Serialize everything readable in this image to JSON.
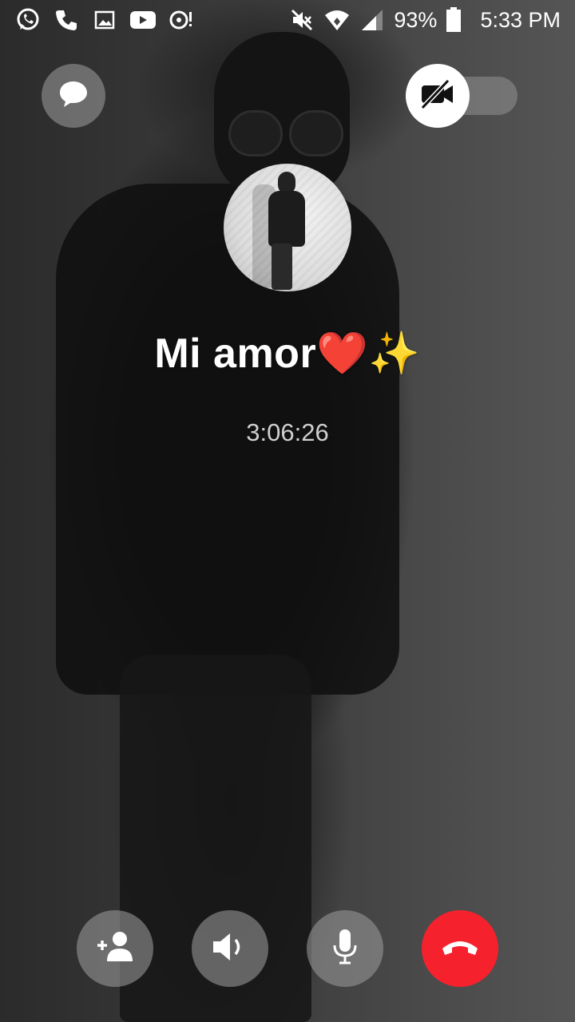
{
  "status_bar": {
    "left_icons": [
      "whatsapp-icon",
      "phone-icon",
      "gallery-icon",
      "youtube-icon",
      "media-notification-icon"
    ],
    "right_icons": [
      "mute-icon",
      "wifi-icon",
      "signal-icon",
      "battery-icon"
    ],
    "battery": "93%",
    "time": "5:33 PM"
  },
  "call": {
    "contact_name": "Mi amor❤️✨",
    "duration": "3:06:26",
    "video_enabled": false
  },
  "top_controls": {
    "chat_icon": "chat-bubble-icon",
    "video_icon": "video-off-icon"
  },
  "bottom_controls": [
    {
      "name": "add-person-button",
      "icon": "add-person-icon"
    },
    {
      "name": "speaker-button",
      "icon": "speaker-icon"
    },
    {
      "name": "mute-button",
      "icon": "microphone-icon"
    },
    {
      "name": "end-call-button",
      "icon": "hang-up-icon"
    }
  ],
  "colors": {
    "end_call": "#f5222d",
    "control_bg": "#969696"
  }
}
